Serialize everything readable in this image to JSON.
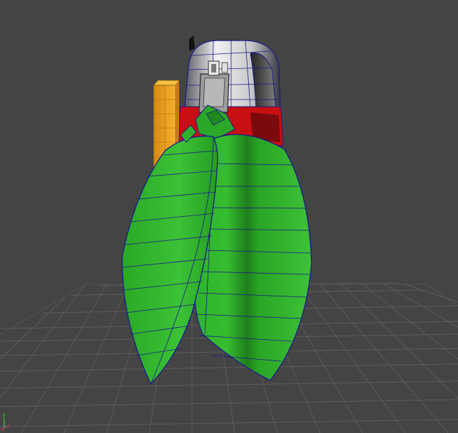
{
  "viewport": {
    "background": "#444444",
    "grid_color": "#5b5b5b",
    "mesh_wire_color": "#1a1a8c",
    "leaf_color": "#2eb52a",
    "leaf_shadow_color": "#1f8f1c",
    "band_red": "#c80f14",
    "block_orange": "#f0a020"
  },
  "axis_indicator": {
    "y_label": "y",
    "x_label": "x",
    "y_color": "#3fd03f",
    "x_color": "#e04040"
  },
  "icons": {
    "mesh": "3d-model-icon"
  }
}
